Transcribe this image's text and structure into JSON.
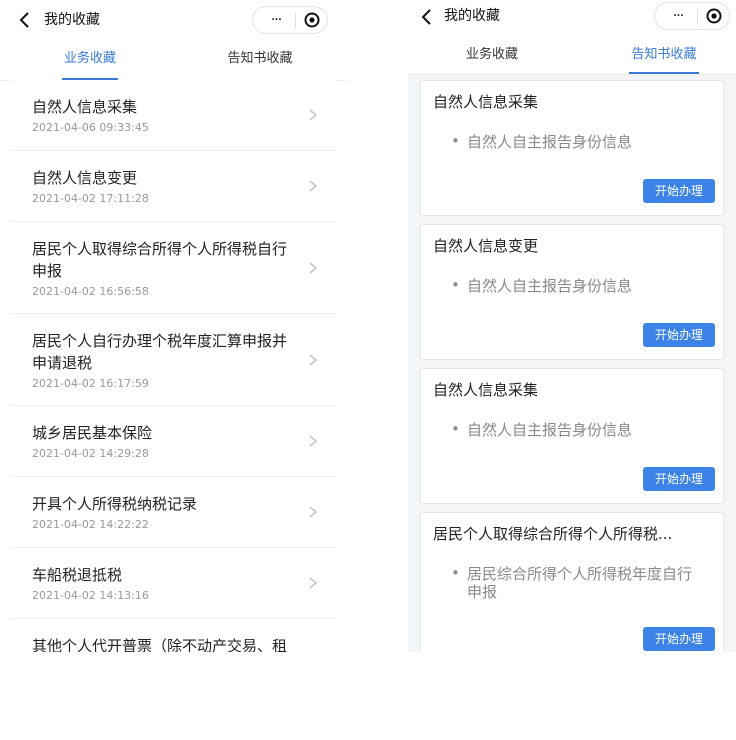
{
  "left": {
    "title": "我的收藏",
    "more_icon": "···",
    "tabs": [
      {
        "label": "业务收藏",
        "active": true
      },
      {
        "label": "告知书收藏",
        "active": false
      }
    ],
    "items": [
      {
        "name": "自然人信息采集",
        "date": "2021-04-06 09:33:45"
      },
      {
        "name": "自然人信息变更",
        "date": "2021-04-02 17:11:28"
      },
      {
        "name": "居民个人取得综合所得个人所得税自行申报",
        "date": "2021-04-02 16:56:58"
      },
      {
        "name": "居民个人自行办理个税年度汇算申报并申请退税",
        "date": "2021-04-02 16:17:59"
      },
      {
        "name": "城乡居民基本保险",
        "date": "2021-04-02 14:29:28"
      },
      {
        "name": "开具个人所得税纳税记录",
        "date": "2021-04-02 14:22:22"
      },
      {
        "name": "车船税退抵税",
        "date": "2021-04-02 14:13:16"
      },
      {
        "name": "其他个人代开普票（除不动产交易、租",
        "date": ""
      }
    ]
  },
  "right": {
    "title": "我的收藏",
    "more_icon": "···",
    "tabs": [
      {
        "label": "业务收藏",
        "active": false
      },
      {
        "label": "告知书收藏",
        "active": true
      }
    ],
    "cards": [
      {
        "title": "自然人信息采集",
        "bullet": "•",
        "desc": "自然人自主报告身份信息",
        "button": "开始办理"
      },
      {
        "title": "自然人信息变更",
        "bullet": "•",
        "desc": "自然人自主报告身份信息",
        "button": "开始办理"
      },
      {
        "title": "自然人信息采集",
        "bullet": "•",
        "desc": "自然人自主报告身份信息",
        "button": "开始办理"
      },
      {
        "title": "居民个人取得综合所得个人所得税...",
        "bullet": "•",
        "desc": "居民综合所得个人所得税年度自行申报",
        "button": "开始办理"
      }
    ]
  },
  "colors": {
    "accent": "#3a7bd5",
    "button": "#3b83e6",
    "muted": "#999999"
  },
  "icons": {
    "back": "chevron-left-icon",
    "more": "more-dots-icon",
    "target": "target-icon",
    "row_arrow": "chevron-right-icon"
  }
}
